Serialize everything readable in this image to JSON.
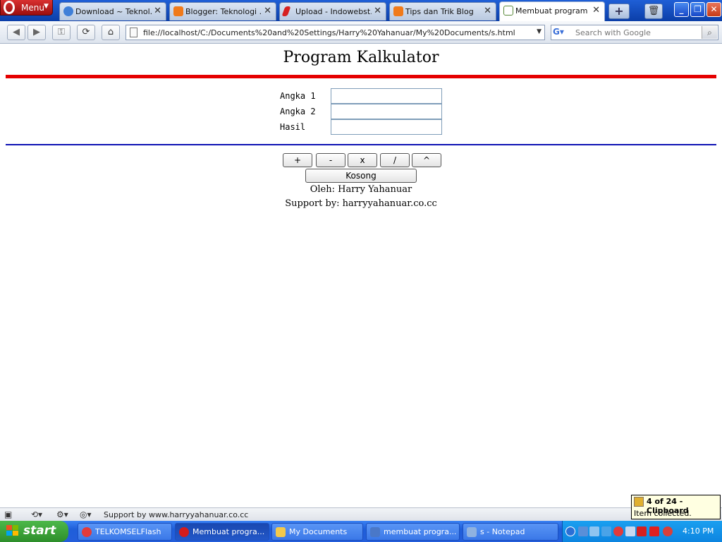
{
  "browser": {
    "menu_label": "Menu",
    "tabs": [
      {
        "title": "Download ~ Teknol...",
        "icon_color": "#3f7fd8"
      },
      {
        "title": "Blogger: Teknologi ...",
        "icon_color": "#f07a1a"
      },
      {
        "title": "Upload - Indowebst...",
        "icon_color": "#d62020"
      },
      {
        "title": "Tips dan Trik Blog",
        "icon_color": "#f07a1a"
      },
      {
        "title": "Membuat program ...",
        "icon_color": "#5a8a3a"
      }
    ],
    "new_tab_label": "+",
    "url": "file://localhost/C:/Documents%20and%20Settings/Harry%20Yahanuar/My%20Documents/s.html",
    "search_placeholder": "Search with Google"
  },
  "page": {
    "title": "Program Kalkulator",
    "fields": [
      {
        "label": "Angka 1",
        "value": ""
      },
      {
        "label": "Angka 2",
        "value": ""
      },
      {
        "label": "Hasil",
        "value": ""
      }
    ],
    "operators": [
      "+",
      "-",
      "x",
      "/",
      "^"
    ],
    "clear_label": "Kosong",
    "author": "Oleh: Harry Yahanuar",
    "support": "Support by: harryyahanuar.co.cc",
    "accent_red": "#e50000",
    "accent_blue": "#0d12b4"
  },
  "statusbar": {
    "text": "Support by www.harryyahanuar.co.cc"
  },
  "tooltip": {
    "title": "4 of 24 - Clipboard",
    "body": "Item collected."
  },
  "taskbar": {
    "start_label": "start",
    "tasks": [
      {
        "label": "TELKOMSELFlash",
        "icon_color": "#e23b3b"
      },
      {
        "label": "Membuat progra...",
        "icon_color": "#d41c1c"
      },
      {
        "label": "My Documents",
        "icon_color": "#f2c94c"
      },
      {
        "label": "membuat progra...",
        "icon_color": "#4a78c8"
      },
      {
        "label": "s - Notepad",
        "icon_color": "#8fb2e0"
      }
    ],
    "clock": "4:10 PM"
  }
}
